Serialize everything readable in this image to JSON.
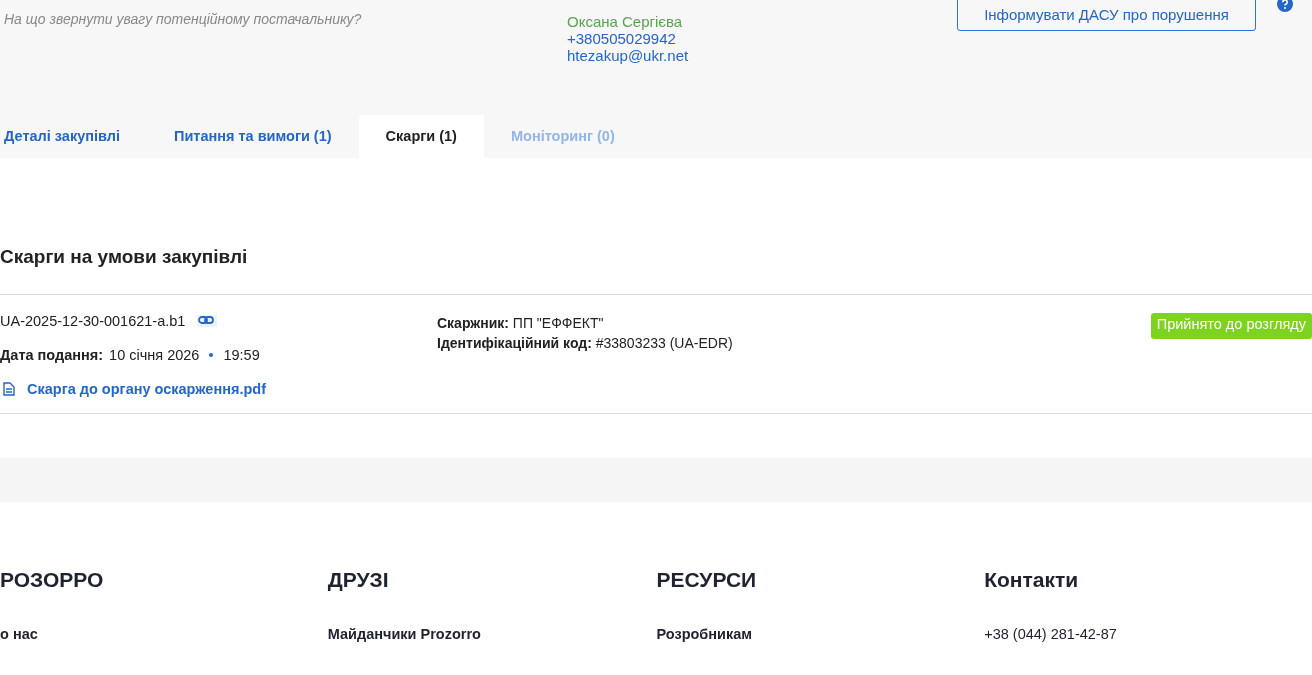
{
  "header": {
    "hint": "На що звернути увагу потенційному постачальнику?",
    "contact": {
      "name": "Оксана Сергієва",
      "phone": "+380505029942",
      "email": "htezakup@ukr.net"
    },
    "report_button": "Інформувати ДАСУ про порушення"
  },
  "tabs": [
    {
      "label": "Деталі закупівлі",
      "selected": false,
      "disabled": false
    },
    {
      "label": "Питання та вимоги (1)",
      "selected": false,
      "disabled": false
    },
    {
      "label": "Скарги (1)",
      "selected": true,
      "disabled": false
    },
    {
      "label": "Моніторинг (0)",
      "selected": false,
      "disabled": true
    }
  ],
  "complaints": {
    "title": "Скарги на умови закупівлі",
    "items": [
      {
        "id": "UA-2025-12-30-001621-a.b1",
        "date_label": "Дата подання:",
        "date": "10 січня 2026",
        "time": "19:59",
        "document": "Скарга до органу оскарження.pdf",
        "complainant_label": "Скаржник:",
        "complainant": "ПП \"ЕФФЕКТ\"",
        "code_label": "Ідентифікаційний код:",
        "code": "#33803233 (UA-EDR)",
        "status": "Прийнято до розгляду",
        "color": "#7ed321"
      }
    ]
  },
  "footer": {
    "columns": [
      {
        "heading": "РОЗОРРО",
        "links": [
          "о нас"
        ]
      },
      {
        "heading": "ДРУЗІ",
        "links": [
          "Майданчики Prozorro"
        ]
      },
      {
        "heading": "РЕСУРСИ",
        "links": [
          "Розробникам"
        ]
      },
      {
        "heading": "Контакти",
        "links": [
          "+38 (044) 281-42-87"
        ]
      }
    ]
  }
}
